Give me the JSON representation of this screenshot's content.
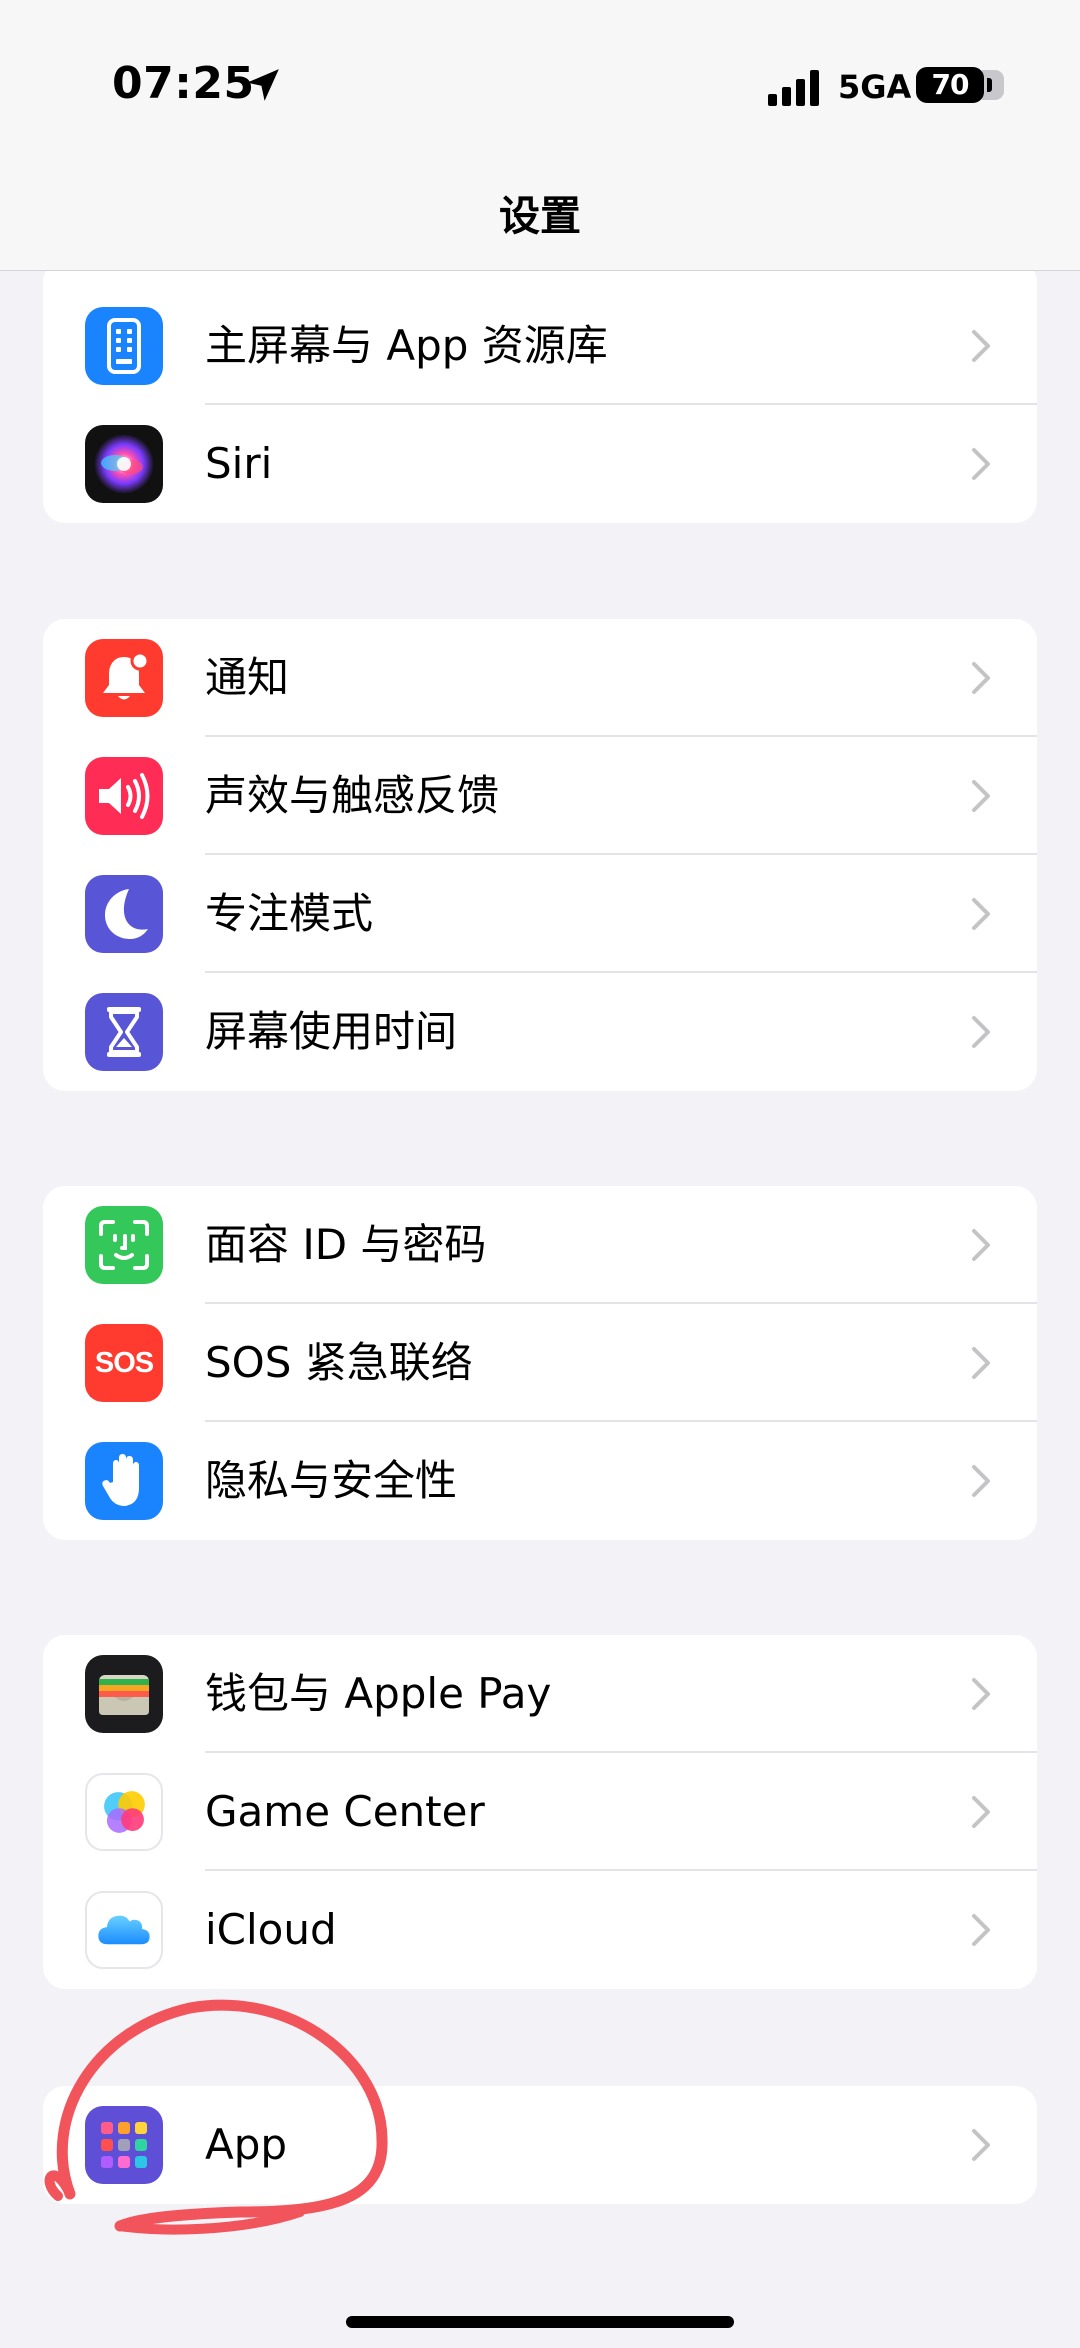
{
  "status_bar": {
    "time": "07:25",
    "network": "5GA",
    "battery": "70"
  },
  "nav": {
    "title": "设置"
  },
  "groups": [
    {
      "items": [
        {
          "label": "主屏幕与 App 资源库",
          "icon": "home-screen-icon",
          "color": "#1a84ff"
        },
        {
          "label": "Siri",
          "icon": "siri-icon",
          "color": "#111111"
        }
      ]
    },
    {
      "items": [
        {
          "label": "通知",
          "icon": "bell-icon",
          "color": "#ff3b30"
        },
        {
          "label": "声效与触感反馈",
          "icon": "speaker-icon",
          "color": "#ff2d55"
        },
        {
          "label": "专注模式",
          "icon": "moon-icon",
          "color": "#5856d6"
        },
        {
          "label": "屏幕使用时间",
          "icon": "hourglass-icon",
          "color": "#5856d6"
        }
      ]
    },
    {
      "items": [
        {
          "label": "面容 ID 与密码",
          "icon": "face-id-icon",
          "color": "#34c759"
        },
        {
          "label": "SOS 紧急联络",
          "icon": "sos-icon",
          "color": "#ff3b30",
          "icon_text": "SOS"
        },
        {
          "label": "隐私与安全性",
          "icon": "hand-icon",
          "color": "#1a84ff"
        }
      ]
    },
    {
      "items": [
        {
          "label": "钱包与 Apple Pay",
          "icon": "wallet-icon",
          "color": "#1c1c1e"
        },
        {
          "label": "Game Center",
          "icon": "game-center-icon",
          "color": "#ffffff"
        },
        {
          "label": "iCloud",
          "icon": "icloud-icon",
          "color": "#ffffff"
        }
      ]
    },
    {
      "items": [
        {
          "label": "App",
          "icon": "apps-grid-icon",
          "color": "#5e4fd6"
        }
      ]
    }
  ]
}
